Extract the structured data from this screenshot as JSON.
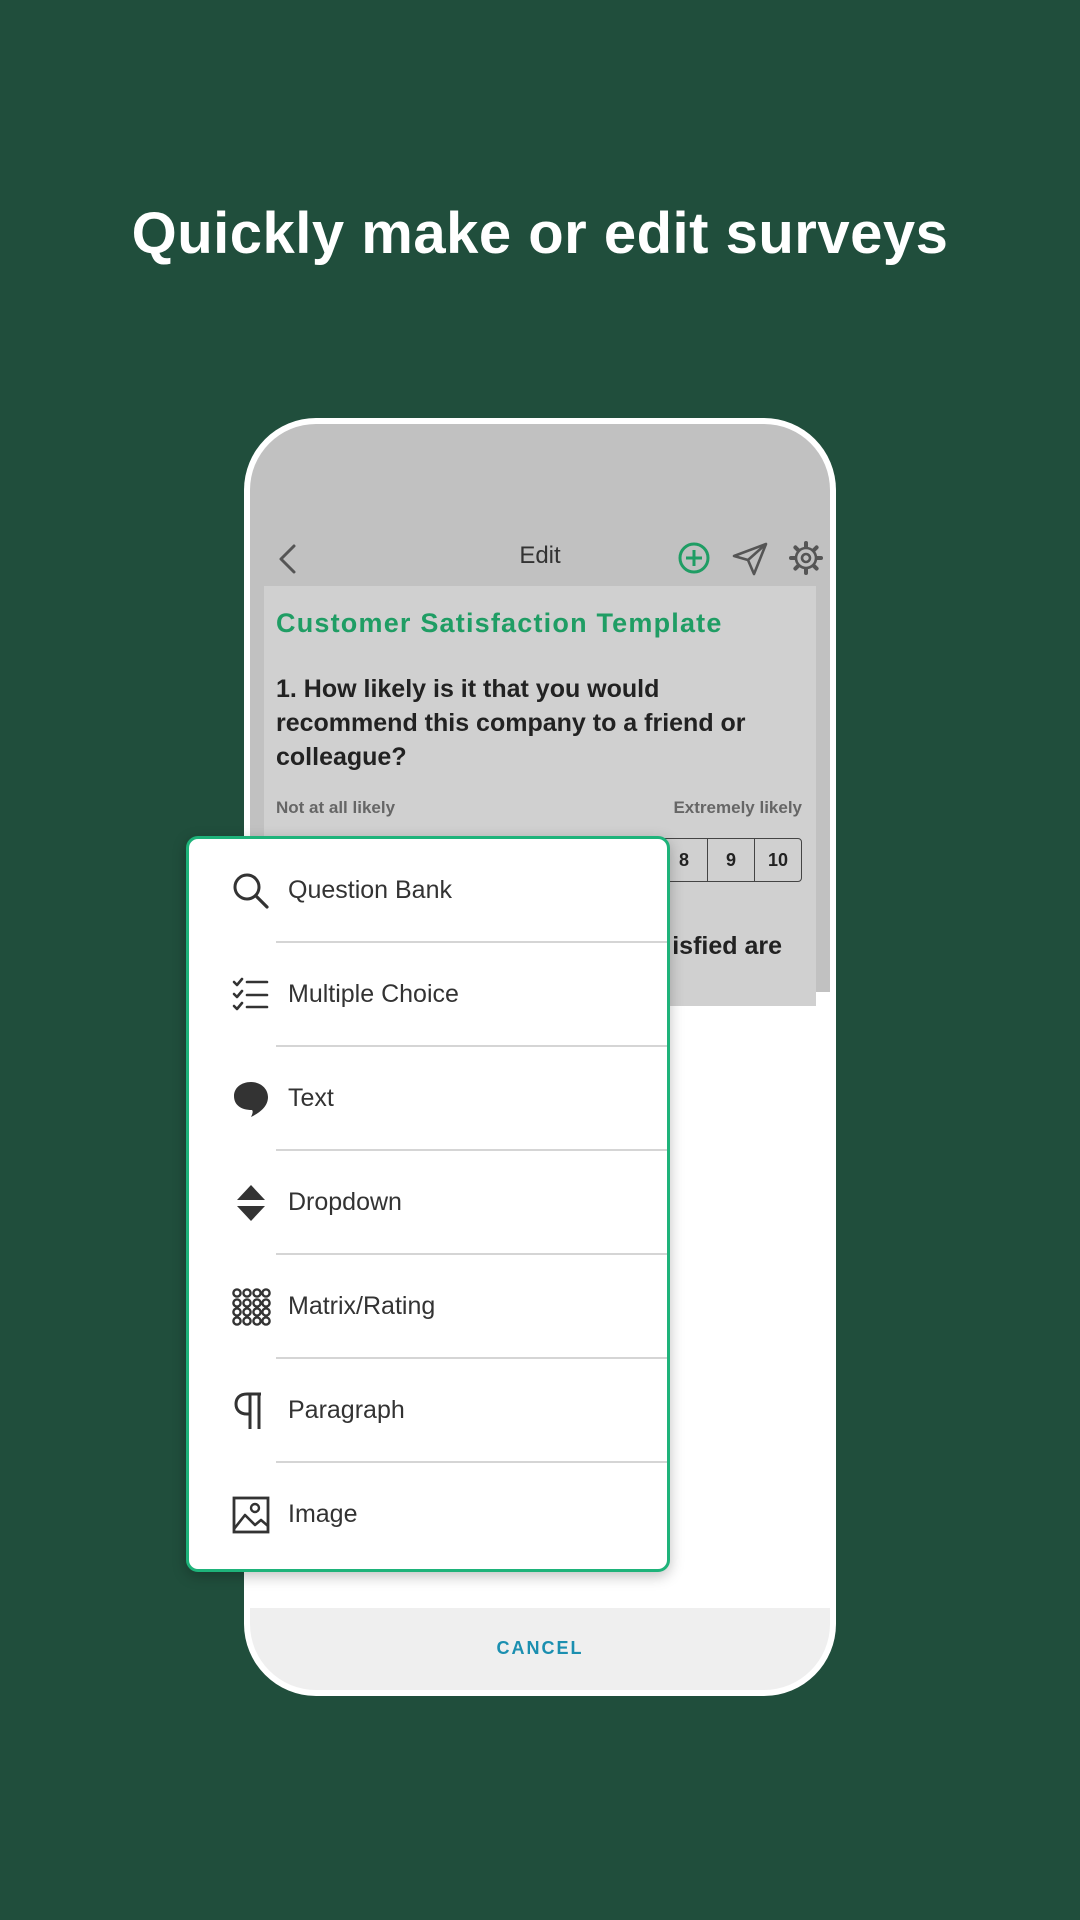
{
  "headline": "Quickly make or edit surveys",
  "nav": {
    "title": "Edit"
  },
  "survey": {
    "template_title": "Customer Satisfaction Template",
    "question_1": "1. How likely is it that you would recommend this company to a friend or colleague?",
    "low_label": "Not at all likely",
    "high_label": "Extremely likely",
    "scale": [
      "8",
      "9",
      "10"
    ],
    "question_2_partial": "isfied are"
  },
  "menu": {
    "items": [
      {
        "label": "Question Bank",
        "icon": "search-icon"
      },
      {
        "label": "Multiple Choice",
        "icon": "checklist-icon"
      },
      {
        "label": "Text",
        "icon": "speech-bubble-icon"
      },
      {
        "label": "Dropdown",
        "icon": "dropdown-arrows-icon"
      },
      {
        "label": "Matrix/Rating",
        "icon": "dot-grid-icon"
      },
      {
        "label": "Paragraph",
        "icon": "pilcrow-icon"
      },
      {
        "label": "Image",
        "icon": "image-icon"
      }
    ]
  },
  "cancel_label": "CANCEL",
  "colors": {
    "background": "#204e3c",
    "accent": "#1eb37a",
    "link": "#1b8fb0"
  }
}
